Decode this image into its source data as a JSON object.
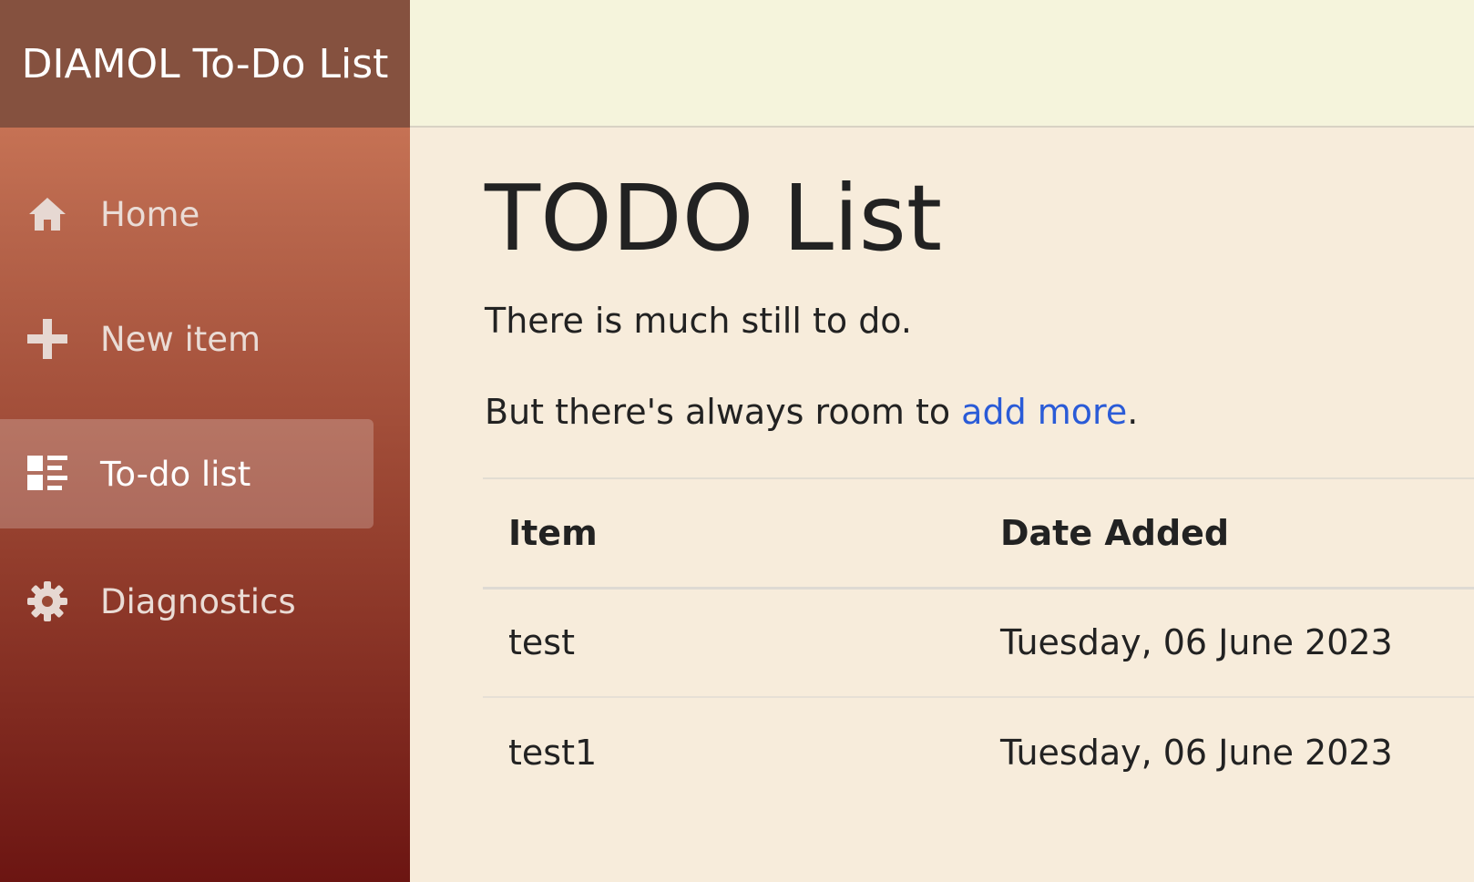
{
  "app": {
    "title": "DIAMOL To-Do List"
  },
  "sidebar": {
    "items": [
      {
        "label": "Home",
        "icon": "home-icon"
      },
      {
        "label": "New item",
        "icon": "plus-icon"
      },
      {
        "label": "To-do list",
        "icon": "list-icon",
        "active": true
      },
      {
        "label": "Diagnostics",
        "icon": "gear-icon"
      }
    ]
  },
  "main": {
    "title": "TODO List",
    "lead_1": "There is much still to do.",
    "lead_2_prefix": "But there's always room to ",
    "lead_2_link": "add more",
    "lead_2_suffix": ".",
    "table": {
      "headers": [
        "Item",
        "Date Added"
      ],
      "rows": [
        [
          "test",
          "Tuesday, 06 June 2023"
        ],
        [
          "test1",
          "Tuesday, 06 June 2023"
        ]
      ]
    }
  },
  "colors": {
    "sidebar_brand_bg": "#85513f",
    "sidebar_gradient_top": "#d9825f",
    "sidebar_gradient_bottom": "#6c1512",
    "topbar_bg": "#f5f4dc",
    "main_bg": "#f7ecdb",
    "link": "#2a5bd7",
    "text": "#222222"
  }
}
